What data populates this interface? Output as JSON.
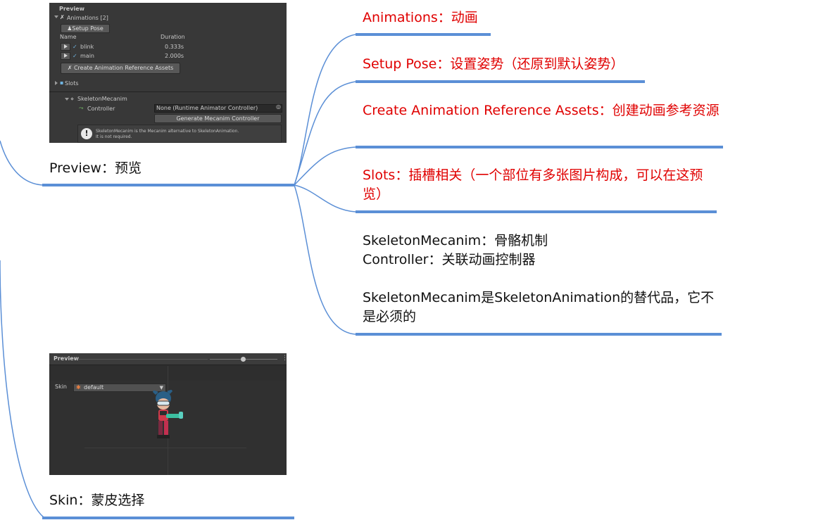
{
  "colors": {
    "accent_bar": "#5b8fd6",
    "connector": "#5b8fd6",
    "highlight_text": "#e00000",
    "normal_text": "#111111"
  },
  "nodes": {
    "preview": "Preview：预览",
    "skin": "Skin：蒙皮选择",
    "animations": "Animations：动画",
    "setup_pose": "Setup Pose：设置姿势（还原到默认姿势）",
    "create_ref": "Create Animation Reference Assets：创建动画参考资源",
    "slots": "Slots：插槽相关（一个部位有多张图片构成，可以在这预览）",
    "mecanim_line1": "SkeletonMecanim：骨骼机制",
    "mecanim_line2": "Controller：关联动画控制器",
    "mecanim_line3": "SkeletonMecanim是SkeletonAnimation的替代品，它不是必须的"
  },
  "screenshot1": {
    "header": "Preview",
    "animations_title": "Animations [2]",
    "setup_pose_btn": "Setup Pose",
    "col_name": "Name",
    "col_duration": "Duration",
    "rows": [
      {
        "name": "blink",
        "duration": "0.333s"
      },
      {
        "name": "main",
        "duration": "2.000s"
      }
    ],
    "create_btn": "Create Animation Reference Assets",
    "slots_label": "Slots",
    "component": "SkeletonMecanim",
    "controller_label": "Controller",
    "controller_value": "None (Runtime Animator Controller)",
    "generate_btn": "Generate Mecanim Controller",
    "help_line1": "SkeletonMecanim is the Mecanim alternative to SkeletonAnimation.",
    "help_line2": "It is not required."
  },
  "screenshot2": {
    "header": "Preview",
    "skin_label": "Skin",
    "skin_value": "default"
  }
}
